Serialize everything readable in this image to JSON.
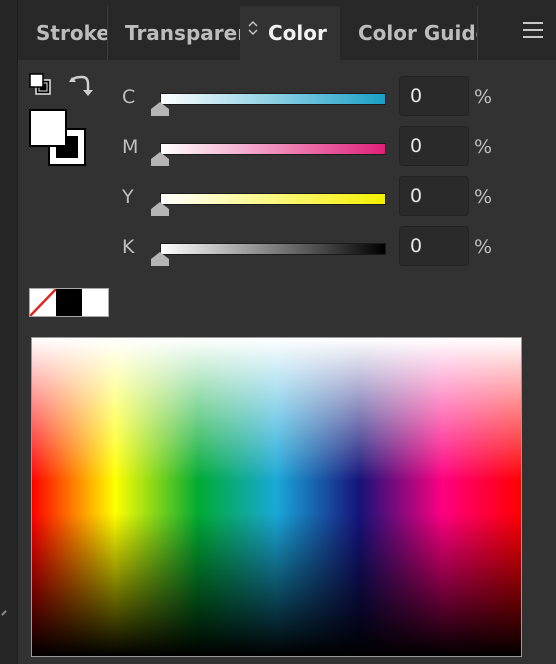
{
  "tabs": [
    {
      "label": "Stroke",
      "active": false
    },
    {
      "label": "Transparen",
      "active": false
    },
    {
      "label": "Color",
      "active": true
    },
    {
      "label": "Color Guide",
      "active": false
    }
  ],
  "active_tab_icon": "updown-arrows-icon",
  "menu_icon": "hamburger-menu-icon",
  "fill_stroke": {
    "fill_color": "#ffffff",
    "stroke_color": "#000000"
  },
  "cmyk": [
    {
      "label": "C",
      "value": "0",
      "unit": "%",
      "color": "#1aa0c8"
    },
    {
      "label": "M",
      "value": "0",
      "unit": "%",
      "color": "#e0207a"
    },
    {
      "label": "Y",
      "value": "0",
      "unit": "%",
      "color": "#f5f000"
    },
    {
      "label": "K",
      "value": "0",
      "unit": "%",
      "color": "#000000"
    }
  ],
  "quick_swatches": [
    "none",
    "#000000",
    "#ffffff"
  ]
}
